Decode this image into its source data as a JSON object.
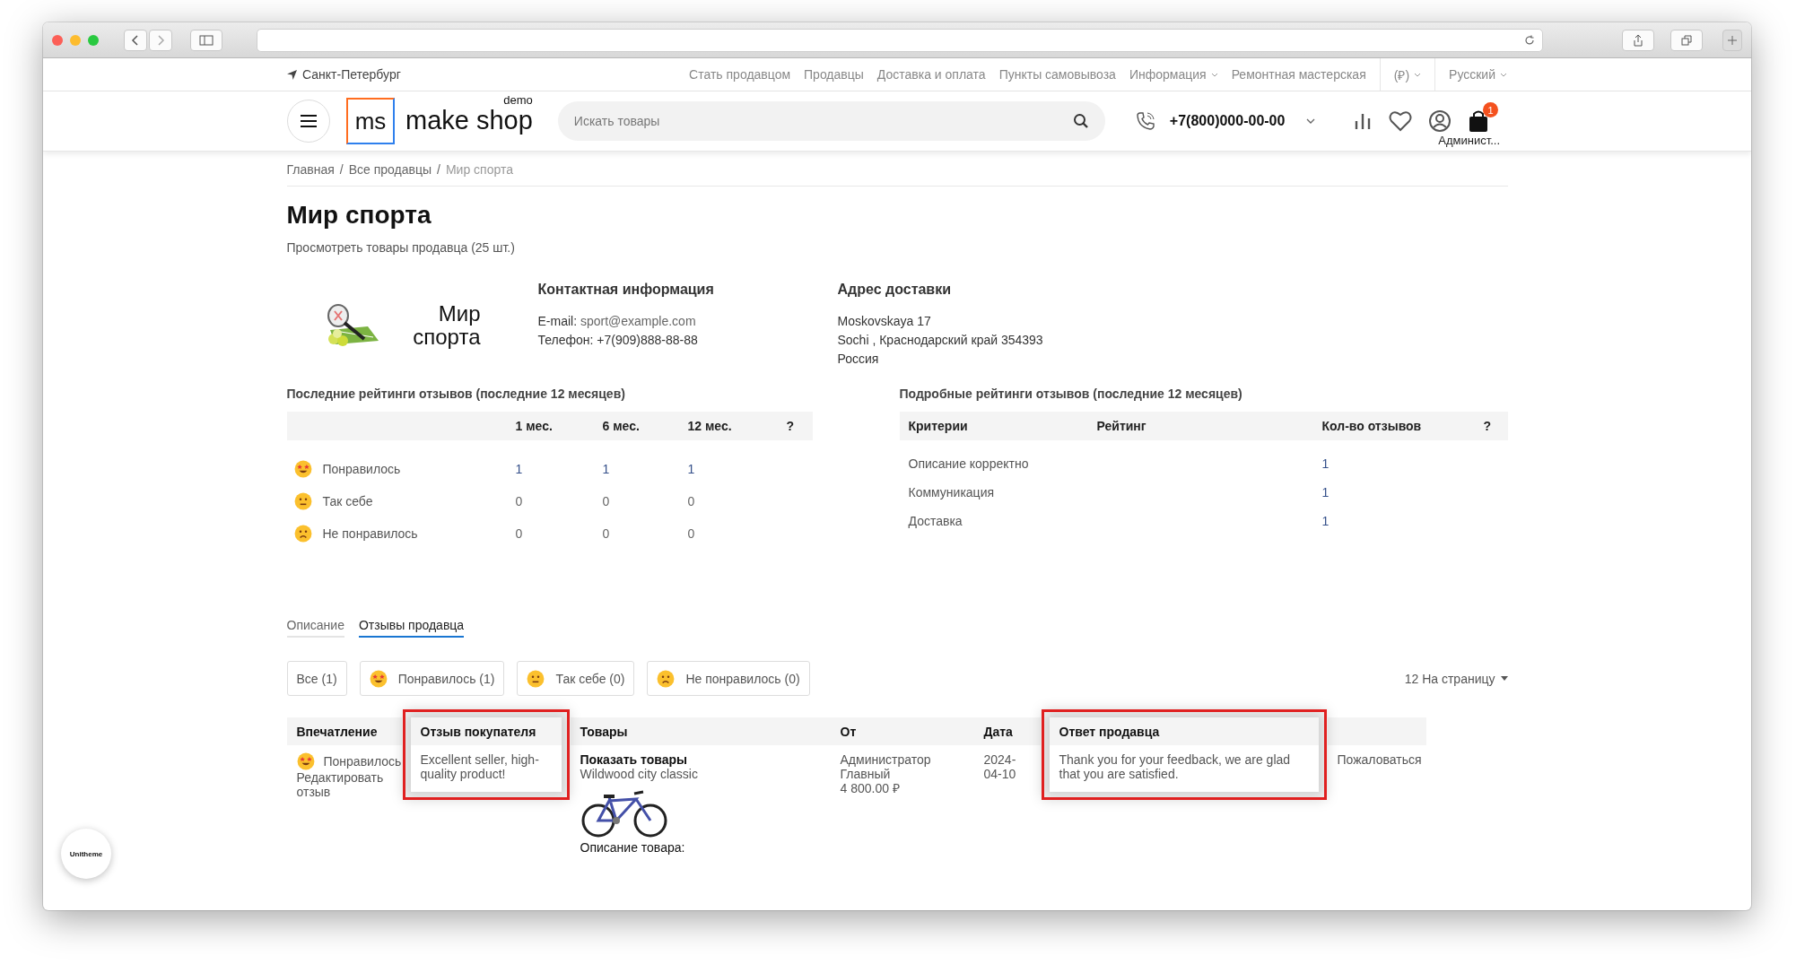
{
  "topbar": {
    "city": "Санкт-Петербург",
    "links": [
      {
        "label": "Стать продавцом",
        "dropdown": false
      },
      {
        "label": "Продавцы",
        "dropdown": false
      },
      {
        "label": "Доставка и оплата",
        "dropdown": false
      },
      {
        "label": "Пункты самовывоза",
        "dropdown": false
      },
      {
        "label": "Информация",
        "dropdown": true
      },
      {
        "label": "Ремонтная мастерская",
        "dropdown": false
      }
    ],
    "currency": "(₽)",
    "language": "Русский"
  },
  "header": {
    "logo_mark": "ms",
    "logo_text": "make shop",
    "logo_badge": "demo",
    "search": {
      "placeholder": "Искать товары"
    },
    "phone": "+7(800)000-00-00",
    "user": "Админист...",
    "cart_count": "1"
  },
  "breadcrumbs": {
    "separator": "/",
    "items": [
      {
        "label": "Главная",
        "current": false
      },
      {
        "label": "Все продавцы",
        "current": false
      },
      {
        "label": "Мир спорта",
        "current": true
      }
    ]
  },
  "title": "Мир спорта",
  "products_link": "Просмотреть товары продавца (25 шт.)",
  "seller_logo_text": "Мир спорта",
  "contact": {
    "title": "Контактная информация",
    "email_label": "E-mail:",
    "email": "sport@example.com",
    "phone": "Телефон: +7(909)888-88-88"
  },
  "address": {
    "title": "Адрес доставки",
    "lines": [
      "Moskovskaya 17",
      "Sochi , Краснодарский край 354393",
      "Россия"
    ]
  },
  "recent_ratings": {
    "title": "Последние рейтинги отзывов (последние 12 месяцев)",
    "columns": [
      "1 мес.",
      "6 мес.",
      "12 мес.",
      "?"
    ],
    "rows": [
      {
        "kind": "positive",
        "label": "Понравилось",
        "values": [
          "1",
          "1",
          "1"
        ]
      },
      {
        "kind": "neutral",
        "label": "Так себе",
        "values": [
          "0",
          "0",
          "0"
        ]
      },
      {
        "kind": "negative",
        "label": "Не понравилось",
        "values": [
          "0",
          "0",
          "0"
        ]
      }
    ]
  },
  "detailed_ratings": {
    "title": "Подробные рейтинги отзывов (последние 12 месяцев)",
    "columns": [
      "Критерии",
      "Рейтинг",
      "Кол-во отзывов",
      "?"
    ],
    "rows": [
      {
        "criterion": "Описание корректно",
        "count": "1"
      },
      {
        "criterion": "Коммуникация",
        "count": "1"
      },
      {
        "criterion": "Доставка",
        "count": "1"
      }
    ]
  },
  "tabs": [
    {
      "label": "Описание",
      "selected": false
    },
    {
      "label": "Отзывы продавца",
      "selected": true
    }
  ],
  "filters": [
    {
      "kind": "all",
      "label": "Все (1)"
    },
    {
      "kind": "positive",
      "label": "Понравилось (1)"
    },
    {
      "kind": "neutral",
      "label": "Так себе (0)"
    },
    {
      "kind": "negative",
      "label": "Не понравилось (0)"
    }
  ],
  "per_page": "12 На страницу",
  "reviews": {
    "columns": [
      {
        "label": "Впечатление",
        "highlighted": false
      },
      {
        "label": "Отзыв покупателя",
        "highlighted": true
      },
      {
        "label": "Товары",
        "highlighted": false
      },
      {
        "label": "От",
        "highlighted": false
      },
      {
        "label": "Дата",
        "highlighted": false
      },
      {
        "label": "Ответ продавца",
        "highlighted": true
      }
    ],
    "rows": [
      {
        "impression": {
          "kind": "positive",
          "label": "Понравилось"
        },
        "edit_link": "Редактировать отзыв",
        "review": "Excellent seller, high-quality product!",
        "product": {
          "link": "Показать товары",
          "name": "Wildwood city classic",
          "caption": "Описание товара:"
        },
        "from": [
          "Администратор",
          "Главный",
          "4 800.00 ₽"
        ],
        "date": "2024-04-10",
        "answer": "Thank you for your feedback, we are glad that you are satisfied.",
        "report": "Пожаловаться"
      }
    ]
  },
  "badge": "Unitheme"
}
